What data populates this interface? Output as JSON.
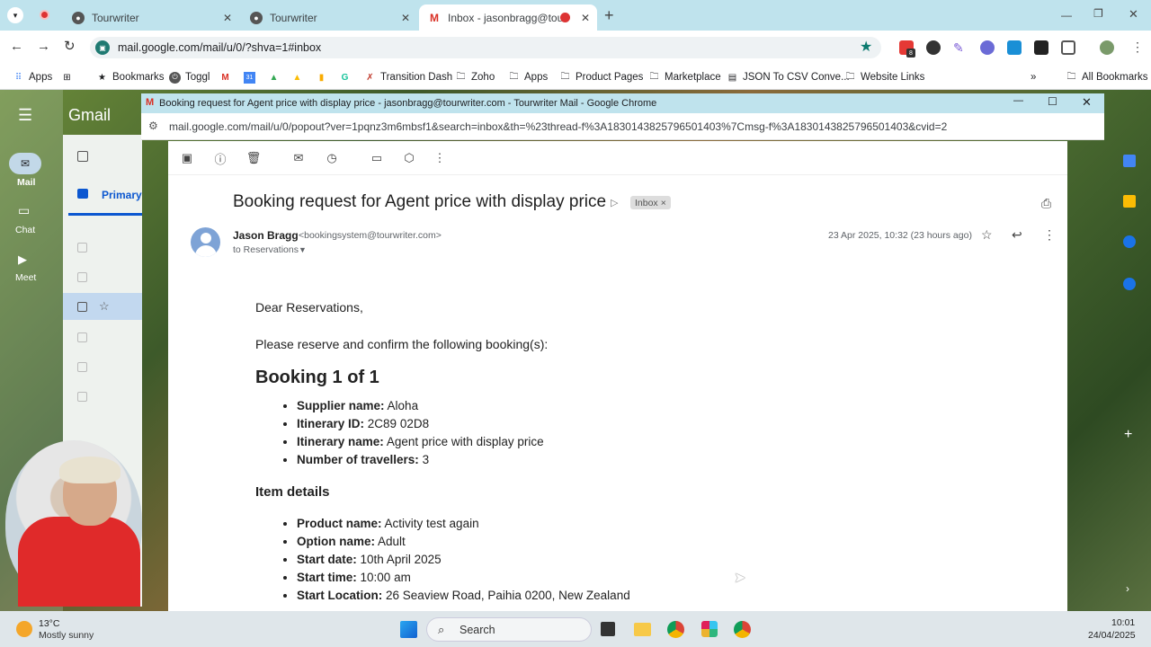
{
  "browser": {
    "tabs": [
      {
        "title": "Tourwriter",
        "active": false
      },
      {
        "title": "Tourwriter",
        "active": false
      },
      {
        "title": "Inbox - jasonbragg@tourwr",
        "active": true
      }
    ],
    "new_tab": "+",
    "url": "mail.google.com/mail/u/0/?shva=1#inbox",
    "bookmarks": [
      "Apps",
      "Bookmarks",
      "Toggl",
      "Transition Dash",
      "Zoho",
      "Apps",
      "Product Pages",
      "Marketplace",
      "JSON To CSV Conve...",
      "Website Links"
    ],
    "all_bookmarks": "All Bookmarks",
    "ext_badge": "8"
  },
  "gmail_bg": {
    "logo": "Gmail",
    "nav": [
      "Mail",
      "Chat",
      "Meet"
    ],
    "primary_tab": "Primary"
  },
  "popup": {
    "window_title": "Booking request for Agent price with display price - jasonbragg@tourwriter.com - Tourwriter Mail - Google Chrome",
    "url": "mail.google.com/mail/u/0/popout?ver=1pqnz3m6mbsf1&search=inbox&th=%23thread-f%3A1830143825796501403%7Cmsg-f%3A1830143825796501403&cvid=2"
  },
  "email": {
    "subject": "Booking request for Agent price with display price",
    "label": "Inbox",
    "sender_name": "Jason Bragg",
    "sender_email": "<bookingsystem@tourwriter.com>",
    "to_line": "to Reservations",
    "date": "23 Apr 2025, 10:32 (23 hours ago)",
    "greeting": "Dear Reservations,",
    "intro": "Please reserve and confirm the following booking(s):",
    "booking_heading": "Booking 1 of 1",
    "booking_fields": [
      {
        "label": "Supplier name:",
        "value": "Aloha"
      },
      {
        "label": "Itinerary ID:",
        "value": "2C89 02D8"
      },
      {
        "label": "Itinerary name:",
        "value": "Agent price with display price"
      },
      {
        "label": "Number of travellers:",
        "value": "3"
      }
    ],
    "item_heading": "Item details",
    "item_fields": [
      {
        "label": "Product name:",
        "value": "Activity test again"
      },
      {
        "label": "Option name:",
        "value": "Adult"
      },
      {
        "label": "Start date:",
        "value": "10th April 2025"
      },
      {
        "label": "Start time:",
        "value": "10:00 am"
      },
      {
        "label": "Start Location:",
        "value": "26 Seaview Road, Paihia 0200, New Zealand"
      }
    ]
  },
  "taskbar": {
    "temp": "13°C",
    "weather": "Mostly sunny",
    "search_placeholder": "Search",
    "time": "10:01",
    "date": "24/04/2025"
  }
}
